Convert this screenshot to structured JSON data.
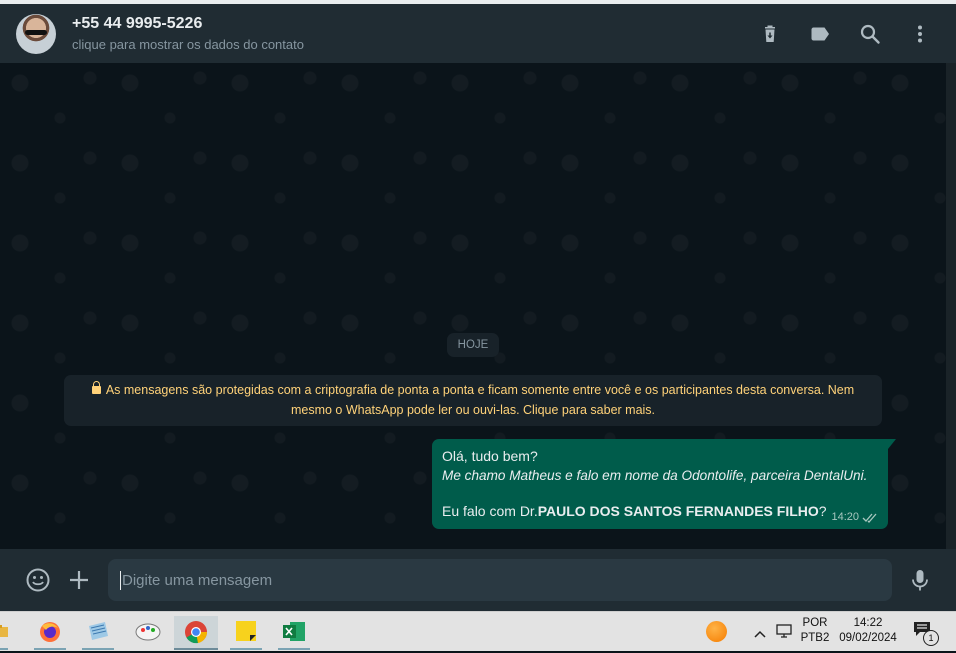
{
  "header": {
    "contact_name": "+55 44 9995-5226",
    "contact_subtitle": "clique para mostrar os dados do contato",
    "icons": [
      "delete-icon",
      "label-icon",
      "search-icon",
      "menu-icon"
    ]
  },
  "chat": {
    "date_chip": "HOJE",
    "encryption_notice_line1": "As mensagens são protegidas com a criptografia de ponta a ponta e ficam somente entre você e os participantes desta conversa. Nem",
    "encryption_notice_line2": "mesmo o WhatsApp pode ler ou ouvi-las. Clique para saber mais.",
    "message": {
      "line1": "Olá, tudo bem?",
      "line2": "Me chamo Matheus e falo em nome da Odontolife, parceira DentalUni.",
      "line3_prefix": "Eu falo com Dr.",
      "line3_bold": "PAULO DOS SANTOS FERNANDES FILHO",
      "line3_suffix": "?",
      "time": "14:20",
      "status": "read-double-check"
    }
  },
  "composer": {
    "placeholder": "Digite uma mensagem",
    "value": ""
  },
  "taskbar": {
    "apps": [
      "file-explorer-icon",
      "firefox-icon",
      "notepad-icon",
      "paint-icon",
      "chrome-icon",
      "sticky-notes-icon",
      "excel-icon"
    ],
    "language_line1": "POR",
    "language_line2": "PTB2",
    "time": "14:22",
    "date": "09/02/2024",
    "notification_count": "1"
  },
  "colors": {
    "header_bg": "#202c33",
    "chat_bg": "#0b141a",
    "outgoing_bubble": "#005c4b",
    "notice_text": "#ffd279",
    "icon": "#aebac1"
  }
}
